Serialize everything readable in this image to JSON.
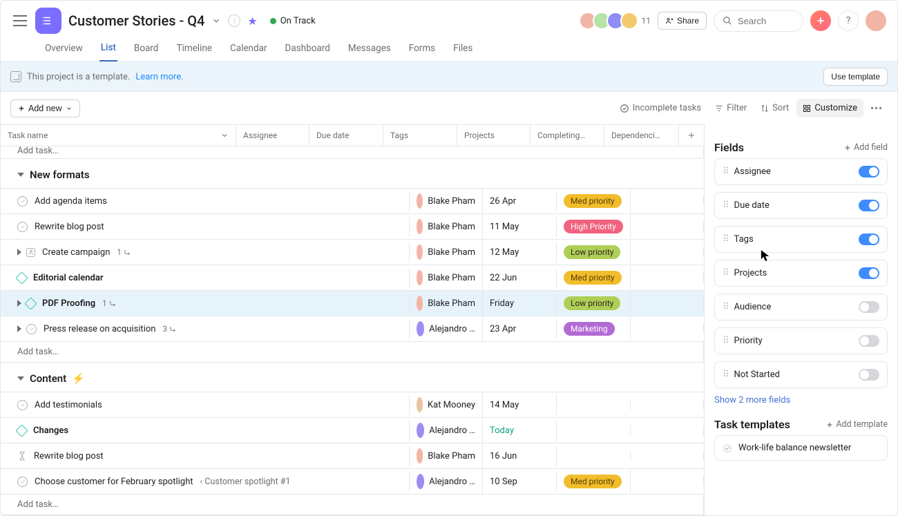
{
  "header": {
    "project_title": "Customer Stories - Q4",
    "status_label": "On Track",
    "share_label": "Share",
    "search_placeholder": "Search",
    "avatar_count": "11"
  },
  "nav": {
    "tabs": [
      "Overview",
      "List",
      "Board",
      "Timeline",
      "Calendar",
      "Dashboard",
      "Messages",
      "Forms",
      "Files"
    ]
  },
  "banner": {
    "text": "This project is a template.",
    "link": "Learn more.",
    "button": "Use template"
  },
  "toolbar": {
    "add_new": "Add new",
    "incomplete": "Incomplete tasks",
    "filter": "Filter",
    "sort": "Sort",
    "customize": "Customize"
  },
  "columns": {
    "task": "Task name",
    "assignee": "Assignee",
    "due": "Due date",
    "tags": "Tags",
    "projects": "Projects",
    "completing": "Completing…",
    "dependencies": "Dependenci…"
  },
  "add_task_placeholder": "Add task…",
  "sections": [
    {
      "name": "New formats",
      "tasks": [
        {
          "icon": "circle",
          "name": "Add agenda items",
          "assignee": "Blake Pham",
          "av": "#f2b5a5",
          "due": "26 Apr",
          "tag": "Med priority",
          "tagc": "med"
        },
        {
          "icon": "circle",
          "name": "Rewrite blog post",
          "assignee": "Blake Pham",
          "av": "#f2b5a5",
          "due": "11 May",
          "tag": "High Priority",
          "tagc": "high"
        },
        {
          "icon": "square",
          "expand": true,
          "name": "Create campaign",
          "sub": "1",
          "assignee": "Blake Pham",
          "av": "#f2b5a5",
          "due": "12 May",
          "tag": "Low priority",
          "tagc": "low"
        },
        {
          "icon": "diamond",
          "name": "Editorial calendar",
          "assignee": "Blake Pham",
          "av": "#f2b5a5",
          "due": "22 Jun",
          "tag": "Med priority",
          "tagc": "med",
          "bold": true
        },
        {
          "icon": "diamond",
          "expand": true,
          "name": "PDF Proofing",
          "sub": "1",
          "assignee": "Blake Pham",
          "av": "#f2b5a5",
          "due": "Friday",
          "tag": "Low priority",
          "tagc": "low",
          "bold": true,
          "hover": true
        },
        {
          "icon": "circle",
          "expand": true,
          "name": "Press release on acquisition",
          "sub": "3",
          "assignee": "Alejandro …",
          "av": "#9f8cf3",
          "due": "23 Apr",
          "tag": "Marketing",
          "tagc": "mkt"
        }
      ]
    },
    {
      "name": "Content",
      "zap": true,
      "tasks": [
        {
          "icon": "circle",
          "name": "Add testimonials",
          "assignee": "Kat Mooney",
          "av": "#e9c4a0",
          "due": "14 May"
        },
        {
          "icon": "diamond",
          "name": "Changes",
          "assignee": "Alejandro …",
          "av": "#9f8cf3",
          "due": "Today",
          "today": true,
          "bold": true
        },
        {
          "icon": "hourglass",
          "name": "Rewrite blog post",
          "assignee": "Blake Pham",
          "av": "#f2b5a5",
          "due": "16 Jun"
        },
        {
          "icon": "circle",
          "name": "Choose customer for February spotlight",
          "parent": "Customer spotlight #1",
          "assignee": "Alejandro …",
          "av": "#9f8cf3",
          "due": "10 Sep",
          "tag": "Med priority",
          "tagc": "med"
        }
      ]
    }
  ],
  "side": {
    "customize_title": "Customize",
    "fields_title": "Fields",
    "add_field": "Add field",
    "fields": [
      {
        "name": "Assignee",
        "on": true
      },
      {
        "name": "Due date",
        "on": true
      },
      {
        "name": "Tags",
        "on": true
      },
      {
        "name": "Projects",
        "on": true
      },
      {
        "name": "Audience",
        "on": false
      },
      {
        "name": "Priority",
        "on": false
      },
      {
        "name": "Not Started",
        "on": false
      }
    ],
    "show_more": "Show 2 more fields",
    "task_templates_title": "Task templates",
    "add_template": "Add template",
    "template_item": "Work-life balance newsletter"
  }
}
